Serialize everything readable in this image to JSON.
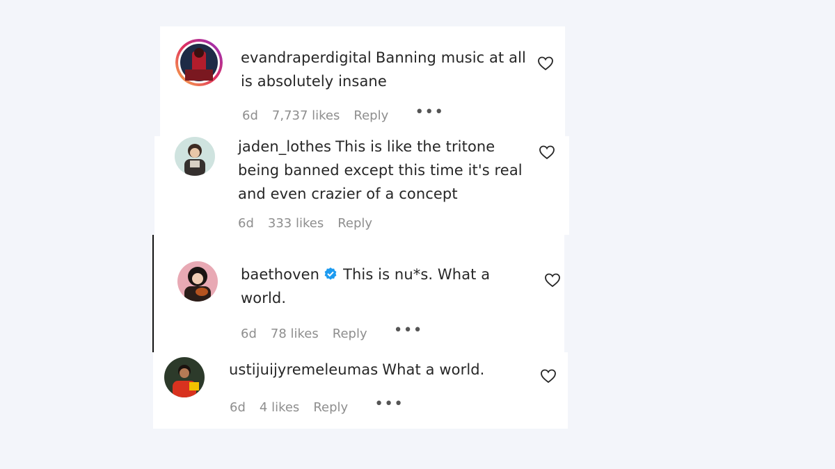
{
  "comments": [
    {
      "username": "evandraperdigital",
      "text": "Banning music at all is absolutely insane",
      "time": "6d",
      "likes": "7,737 likes",
      "reply": "Reply",
      "more": "•••",
      "avatar_colors": [
        "#f9b44a",
        "#e0305e",
        "#8d2fc5"
      ]
    },
    {
      "username": "jaden_lothes",
      "text": "This is like the tritone being banned except this time it's real and even crazier of a concept",
      "time": "6d",
      "likes": "333 likes",
      "reply": "Reply"
    },
    {
      "username": "baethoven",
      "verified_icon": "verified-badge-icon",
      "text": "This is nu*s. What a world.",
      "time": "6d",
      "likes": "78 likes",
      "reply": "Reply",
      "more": "•••"
    },
    {
      "username": "ustijuijyremeleumas",
      "text": "What a world.",
      "time": "6d",
      "likes": "4 likes",
      "reply": "Reply",
      "more": "•••"
    }
  ],
  "colors": {
    "background": "#f3f5fa",
    "card": "#ffffff",
    "text": "#262626",
    "meta": "#8e8e8e",
    "verified": "#1d9bf0"
  }
}
